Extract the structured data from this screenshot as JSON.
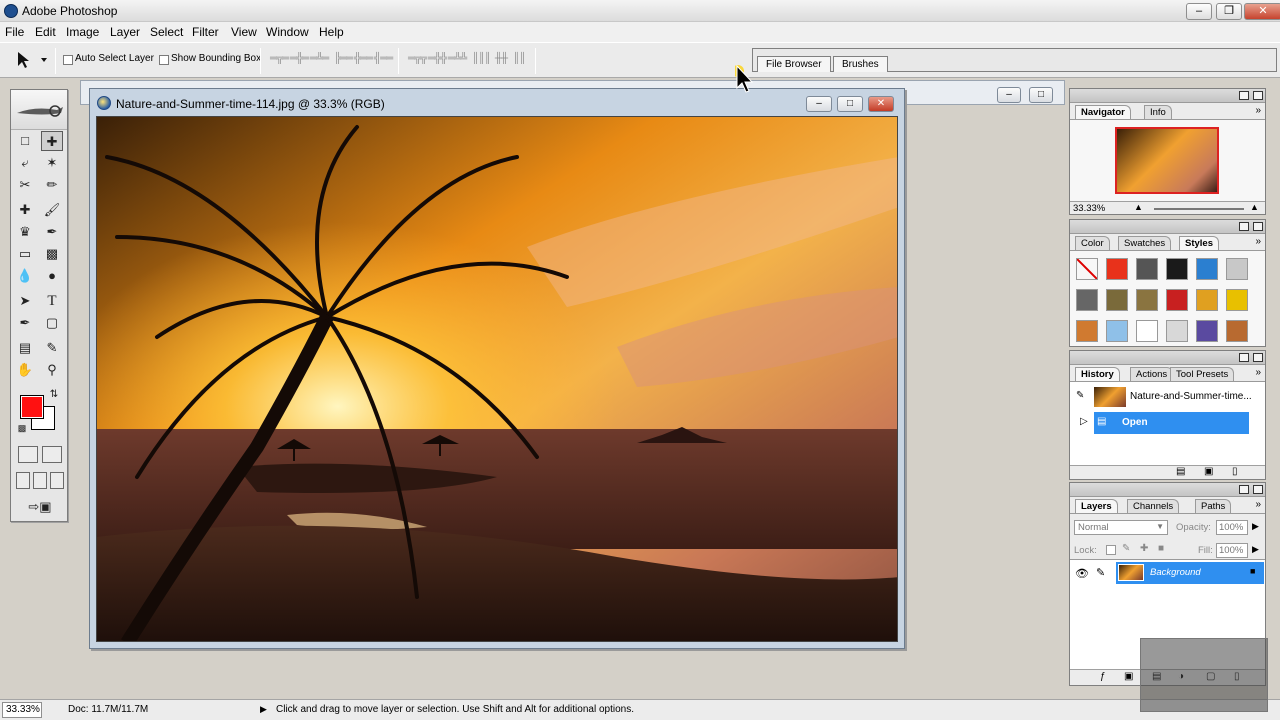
{
  "window": {
    "title": "Adobe Photoshop",
    "minimize": "–",
    "restore": "❐",
    "close": "✕"
  },
  "menu": [
    "File",
    "Edit",
    "Image",
    "Layer",
    "Select",
    "Filter",
    "View",
    "Window",
    "Help"
  ],
  "options": {
    "auto_select_layer": "Auto Select Layer",
    "show_bounding_box": "Show Bounding Box",
    "align_glyphs": [
      "═╦═",
      "═╬═",
      "═╩═",
      "╠══",
      "╬══",
      "╣══",
      "═╦╦",
      "═╬╬",
      "═╩╩",
      "║║║",
      "╫╫",
      "║║"
    ],
    "palette_well_tabs": [
      "File Browser",
      "Brushes"
    ]
  },
  "document": {
    "title": "Nature-and-Summer-time-114.jpg @ 33.3% (RGB)"
  },
  "navigator": {
    "tabs": [
      "Navigator",
      "Info"
    ],
    "zoom": "33.33%"
  },
  "styles_panel": {
    "tabs": [
      "Color",
      "Swatches",
      "Styles"
    ],
    "swatches": [
      "#ffffff",
      "#e8321b",
      "#555555",
      "#1a1a1a",
      "#2b7fd0",
      "#c8c8c8",
      "#666666",
      "#7a6a3a",
      "#8a7440",
      "#c82020",
      "#e0a020",
      "#e8c000",
      "#d07a30",
      "#8fc0e8",
      "#ffffff",
      "#d8d8d8",
      "#5a4aa0",
      "#b86a30"
    ]
  },
  "history": {
    "tabs": [
      "History",
      "Actions",
      "Tool Presets"
    ],
    "snapshot": "Nature-and-Summer-time...",
    "state": "Open"
  },
  "layers": {
    "tabs": [
      "Layers",
      "Channels",
      "Paths"
    ],
    "blend_mode": "Normal",
    "opacity_label": "Opacity:",
    "opacity": "100%",
    "lock_label": "Lock:",
    "fill_label": "Fill:",
    "fill": "100%",
    "layer_name": "Background"
  },
  "status": {
    "zoom": "33.33%",
    "doc": "Doc: 11.7M/11.7M",
    "hint": "Click and drag to move layer or selection. Use Shift and Alt for additional options."
  },
  "colors": {
    "foreground": "#ff1111",
    "background": "#ffffff",
    "selection": "#2f8ff0"
  }
}
